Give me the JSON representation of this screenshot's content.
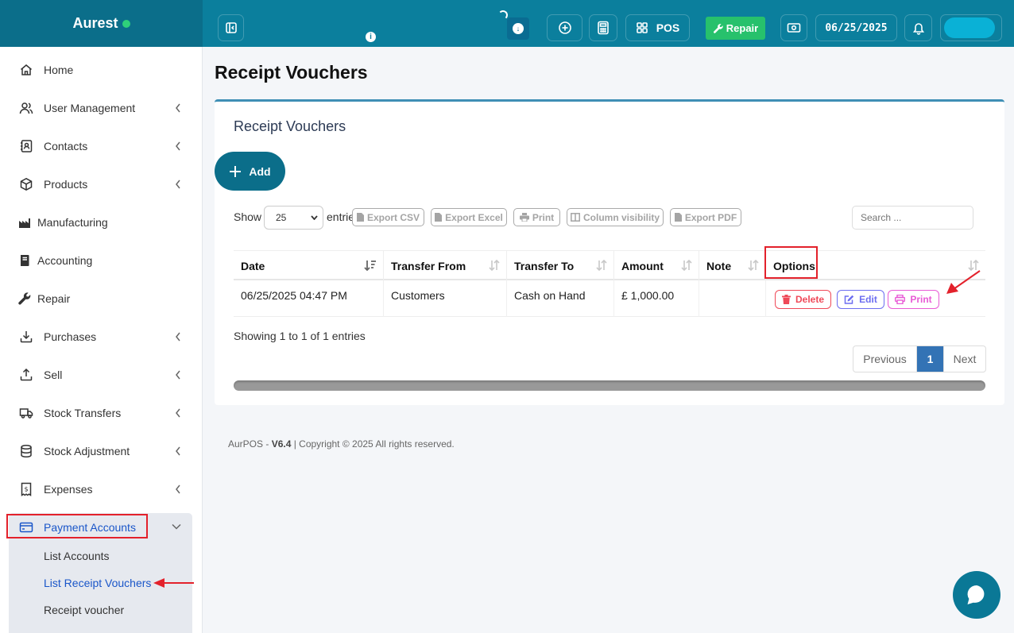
{
  "brand": {
    "name": "Aurest"
  },
  "topbar": {
    "info_glyph": "i",
    "pos_label": "POS",
    "repair_label": "Repair",
    "date": "06/25/2025"
  },
  "sidebar": {
    "items": [
      {
        "label": "Home",
        "icon": "home-icon",
        "chevron": false
      },
      {
        "label": "User Management",
        "icon": "users-icon",
        "chevron": true
      },
      {
        "label": "Contacts",
        "icon": "contacts-icon",
        "chevron": true
      },
      {
        "label": "Products",
        "icon": "box-icon",
        "chevron": true
      },
      {
        "label": "Manufacturing",
        "icon": "factory-icon",
        "chevron": false
      },
      {
        "label": "Accounting",
        "icon": "book-icon",
        "chevron": false
      },
      {
        "label": "Repair",
        "icon": "wrench-icon",
        "chevron": false
      },
      {
        "label": "Purchases",
        "icon": "download-icon",
        "chevron": true
      },
      {
        "label": "Sell",
        "icon": "upload-icon",
        "chevron": true
      },
      {
        "label": "Stock Transfers",
        "icon": "truck-icon",
        "chevron": true
      },
      {
        "label": "Stock Adjustment",
        "icon": "database-icon",
        "chevron": true
      },
      {
        "label": "Expenses",
        "icon": "receipt-icon",
        "chevron": true
      },
      {
        "label": "Payment Accounts",
        "icon": "credit-card-icon",
        "chevron": true,
        "active": true
      }
    ],
    "submenu": [
      {
        "label": "List Accounts"
      },
      {
        "label": "List Receipt Vouchers",
        "active": true
      },
      {
        "label": "Receipt voucher"
      }
    ]
  },
  "page": {
    "title": "Receipt Vouchers",
    "card_title": "Receipt Vouchers",
    "add_label": "Add"
  },
  "table_controls": {
    "show_label": "Show",
    "entries_label": "entries",
    "page_length": "25",
    "export_buttons": [
      "Export CSV",
      "Export Excel",
      "Print",
      "Column visibility",
      "Export PDF"
    ],
    "search_placeholder": "Search ..."
  },
  "table": {
    "columns": [
      "Date",
      "Transfer From",
      "Transfer To",
      "Amount",
      "Note",
      "Options"
    ],
    "rows": [
      {
        "date": "06/25/2025 04:47 PM",
        "from": "Customers",
        "to": "Cash on Hand",
        "amount": "£ 1,000.00",
        "note": ""
      }
    ],
    "row_actions": {
      "delete": "Delete",
      "edit": "Edit",
      "print": "Print"
    }
  },
  "pagination": {
    "info": "Showing 1 to 1 of 1 entries",
    "previous": "Previous",
    "current": "1",
    "next": "Next"
  },
  "footer": {
    "app": "AurPOS - ",
    "version": "V6.4",
    "copyright": " | Copyright © 2025 All rights reserved."
  },
  "colors": {
    "primary": "#0b7f9d",
    "repair": "#27c16c",
    "delete": "#ef4958",
    "edit": "#6d6ef0",
    "print": "#e85bd6",
    "highlight": "#e3212b",
    "active_link": "#1a56c9"
  }
}
